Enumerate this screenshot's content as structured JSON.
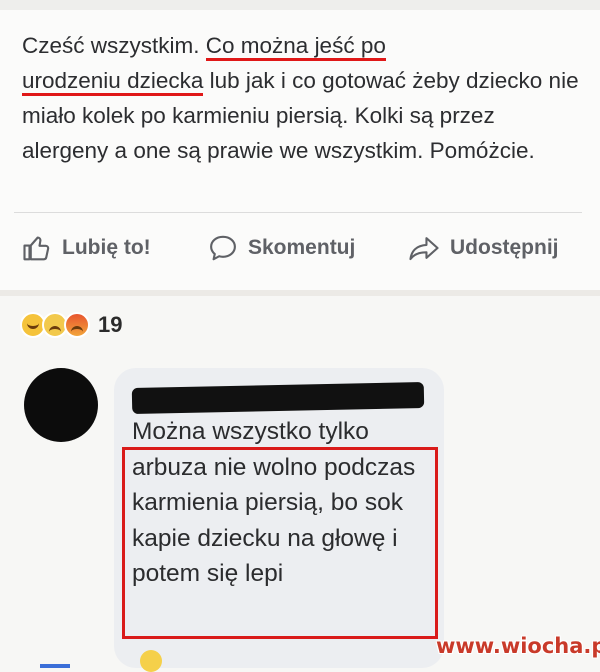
{
  "post": {
    "text_before": "Cześć wszystkim. ",
    "text_underlined_1": "Co można jeść po",
    "text_underlined_2": "urodzeniu dziecka",
    "text_after": " lub jak i co gotować żeby dziecko nie miało kolek po karmieniu piersią. Kolki są przez alergeny a one są prawie we wszystkim. Pomóżcie."
  },
  "actions": {
    "like": "Lubię to!",
    "comment": "Skomentuj",
    "share": "Udostępnij"
  },
  "reactions": {
    "count": "19",
    "icons": [
      "laugh-emoji",
      "sad-emoji",
      "angry-emoji"
    ]
  },
  "comment": {
    "text": "Można wszystko tylko arbuza nie wolno podczas karmienia piersią, bo sok kapie dziecku na głowę i potem się lepi"
  },
  "watermark": "www.wiocha.pl",
  "colors": {
    "highlight_red": "#d91a1a",
    "bubble_bg": "#eceef1"
  }
}
